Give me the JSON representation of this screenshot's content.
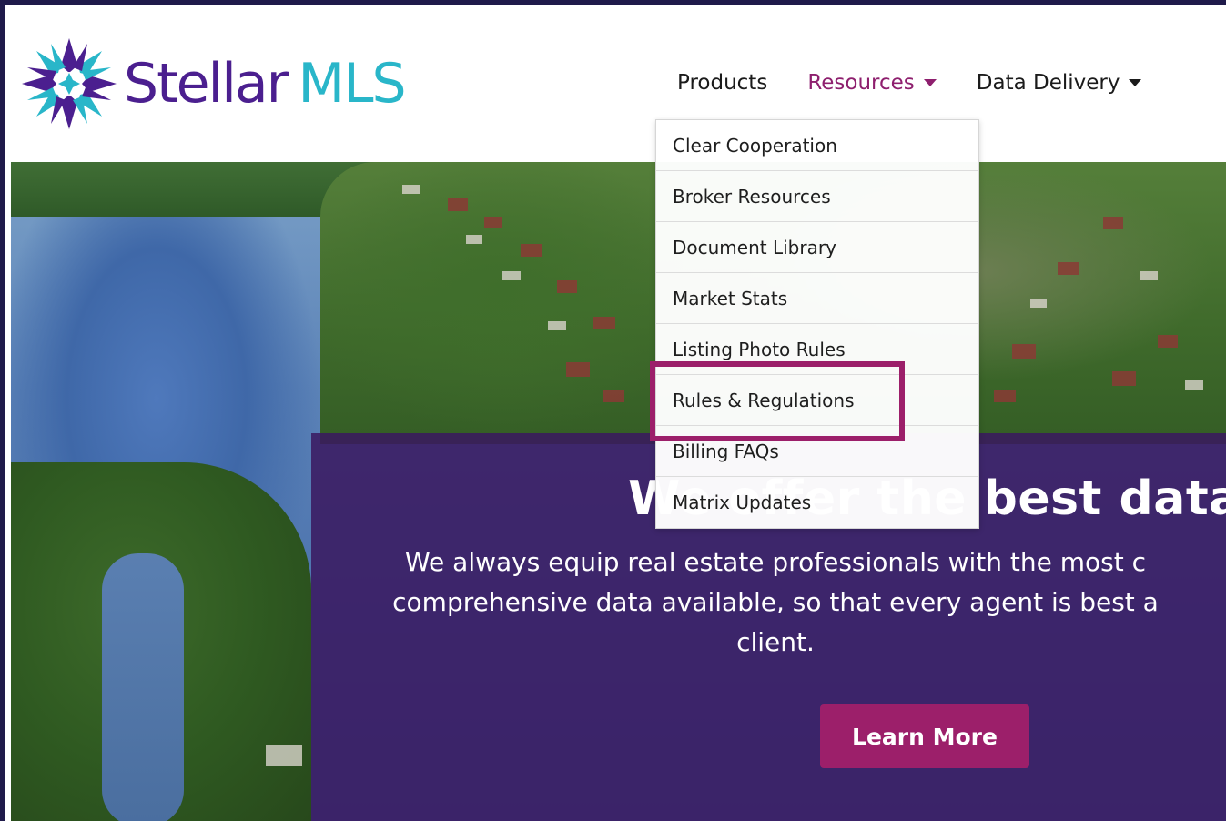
{
  "brand": {
    "name_part1": "Stellar",
    "name_part2": "MLS",
    "colors": {
      "purple": "#4b1f8f",
      "teal": "#29b6c9",
      "accent": "#9c1f6a"
    },
    "logo_icon": "star-burst-icon"
  },
  "nav": {
    "items": [
      {
        "label": "Products",
        "has_caret": false,
        "active": false
      },
      {
        "label": "Resources",
        "has_caret": true,
        "active": true
      },
      {
        "label": "Data Delivery",
        "has_caret": true,
        "active": false
      }
    ]
  },
  "resources_menu": {
    "items": [
      "Clear Cooperation",
      "Broker Resources",
      "Document Library",
      "Market Stats",
      "Listing Photo Rules",
      "Rules & Regulations",
      "Billing FAQs",
      "Matrix Updates"
    ],
    "highlighted": "Rules & Regulations"
  },
  "hero": {
    "heading": "We offer the best data.",
    "sub_lines": [
      "We always equip real estate professionals with the most c",
      "comprehensive data available, so that every agent is best a",
      "client."
    ],
    "cta_label": "Learn More"
  }
}
